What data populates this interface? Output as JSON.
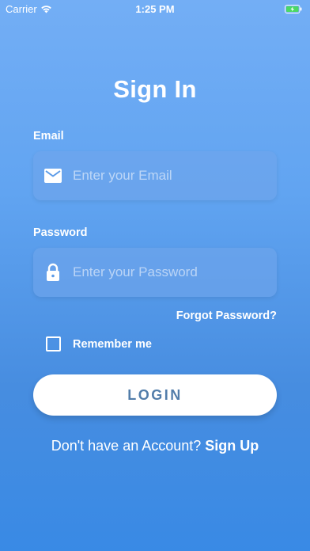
{
  "status_bar": {
    "carrier": "Carrier",
    "time": "1:25 PM",
    "wifi_icon": "wifi-icon",
    "battery_icon": "battery-charging-icon"
  },
  "title": "Sign In",
  "email": {
    "label": "Email",
    "placeholder": "Enter your Email",
    "value": "",
    "icon": "mail-icon"
  },
  "password": {
    "label": "Password",
    "placeholder": "Enter your Password",
    "value": "",
    "icon": "lock-icon"
  },
  "forgot_password": "Forgot Password?",
  "remember_me": {
    "label": "Remember me",
    "checked": false
  },
  "login_button": "LOGIN",
  "signup_prompt": {
    "text": "Don't have an Account? ",
    "link": "Sign Up"
  },
  "colors": {
    "background_top": "#73AEF5",
    "background_bottom": "#398AE5",
    "button_text": "#527DAA",
    "battery": "#4CD964"
  }
}
